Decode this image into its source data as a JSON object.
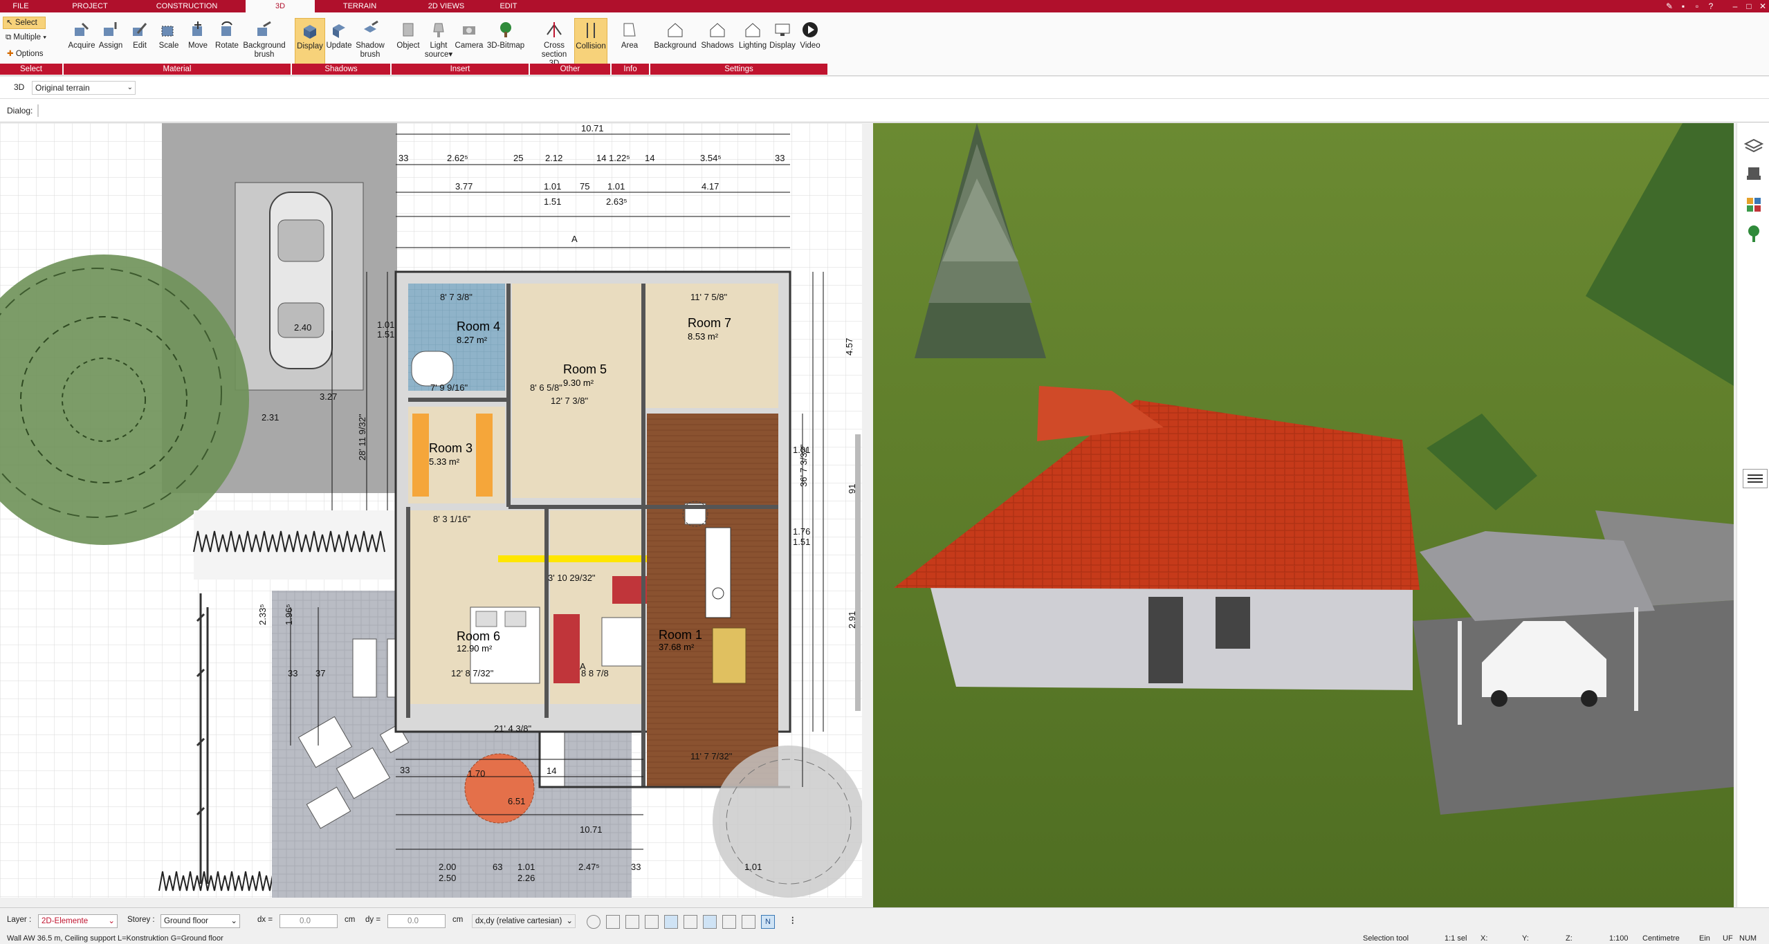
{
  "tabs": [
    {
      "label": "FILE"
    },
    {
      "label": "PROJECT"
    },
    {
      "label": "CONSTRUCTION"
    },
    {
      "label": "3D"
    },
    {
      "label": "TERRAIN"
    },
    {
      "label": "2D VIEWS"
    },
    {
      "label": "EDIT"
    }
  ],
  "ribbon": {
    "select": {
      "select_label": "Select",
      "multiple_label": "Multiple",
      "options_label": "Options"
    },
    "material": {
      "acquire": "Acquire",
      "assign": "Assign",
      "edit": "Edit",
      "scale": "Scale",
      "move": "Move",
      "rotate": "Rotate",
      "background_brush_1": "Background",
      "background_brush_2": "brush"
    },
    "shadows": {
      "display": "Display",
      "update": "Update",
      "shadow_brush_1": "Shadow",
      "shadow_brush_2": "brush"
    },
    "insert": {
      "object": "Object",
      "light_source_1": "Light",
      "light_source_2": "source",
      "camera": "Camera",
      "bitmap": "3D-Bitmap"
    },
    "other": {
      "cross_section_1": "Cross",
      "cross_section_2": "section 3D",
      "collision": "Collision"
    },
    "info": {
      "area": "Area"
    },
    "settings": {
      "background": "Background",
      "shadows": "Shadows",
      "lighting": "Lighting",
      "display": "Display",
      "video": "Video"
    },
    "groups": [
      "Select",
      "Material",
      "Shadows",
      "Insert",
      "Other",
      "Info",
      "Settings"
    ]
  },
  "command_bar": {
    "mode": "3D",
    "terrain_select": "Original terrain"
  },
  "dialog_bar": {
    "label": "Dialog:"
  },
  "plan": {
    "rooms": [
      {
        "name": "Room 4",
        "area": "8.27 m²"
      },
      {
        "name": "Room 7",
        "area": "8.53 m²"
      },
      {
        "name": "Room 5",
        "area": "9.30 m²"
      },
      {
        "name": "Room 3",
        "area": "5.33 m²"
      },
      {
        "name": "Room 6",
        "area": "12.90 m²"
      },
      {
        "name": "Room 1",
        "area": "37.68 m²"
      }
    ],
    "dims": {
      "total_width": "10.71",
      "d1": "33",
      "d2": "2.62⁵",
      "d3": "25",
      "d4": "2.12",
      "d5": "14",
      "d6": "1.22⁵",
      "d7": "14",
      "d8": "3.54⁵",
      "d9": "33",
      "d10": "3.77",
      "d11": "1.01",
      "d12": "75",
      "d13": "1.01",
      "d14": "4.17",
      "d15": "1.51",
      "d16": "2.63⁵",
      "section_label": "A",
      "left1": "1.01",
      "left2": "1.51",
      "left3": "2.40",
      "left4": "3.27",
      "left5": "2.31",
      "left6": "28' 11 9/32\"",
      "right1": "4.57",
      "right2": "1.01",
      "right3": "91",
      "right4": "1.76",
      "right5": "1.51",
      "right6": "36' 7 3/32\"",
      "right7": "2.91",
      "imp1": "11' 7 5/8\"",
      "imp2": "8' 7 3/8\"",
      "imp3": "12' 7 3/8\"",
      "imp4": "8' 6 5/8\"",
      "imp5": "7' 9 9/16\"",
      "imp6": "8' 3 1/16\"",
      "imp7": "12' 8 7/32\"",
      "imp8": "11' 7 7/32\"",
      "imp9": "21' 4 3/8\"",
      "imp10": "3' 10 29/32\"",
      "imp11": "8 8 7/8",
      "bot1": "2.00",
      "bot2": "2.50",
      "bot3": "63",
      "bot4": "1.01",
      "bot5": "2.26",
      "bot6": "2.47⁵",
      "bot7": "33",
      "bot8": "1.01",
      "bot9": "10.71",
      "bot10": "33",
      "bot11": "14",
      "terr1": "2.33⁵",
      "terr2": "1.96⁵",
      "terr3": "37",
      "terr4": "33",
      "terr5": "6.51",
      "terr6": "1.70"
    }
  },
  "input_bar": {
    "layer_label": "Layer :",
    "layer_value": "2D-Elemente",
    "storey_label": "Storey :",
    "storey_value": "Ground floor",
    "dx_label": "dx =",
    "dx_value": "0.0",
    "dx_unit": "cm",
    "dy_label": "dy =",
    "dy_value": "0.0",
    "dy_unit": "cm",
    "coord_mode": "dx,dy (relative cartesian)"
  },
  "status_bar": {
    "info": "Wall AW 36.5 m, Ceiling support L=Konstruktion G=Ground floor",
    "tool": "Selection tool",
    "sel": "1:1 sel",
    "x": "X:",
    "y": "Y:",
    "z": "Z:",
    "scale": "1:100",
    "unit": "Centimetre",
    "ein": "Ein",
    "uf": "UF",
    "num": "NUM"
  },
  "colors": {
    "accent": "#b0102c",
    "roof": "#c43a1c",
    "grass": "#5f7d30",
    "active_btn": "#f7d27a"
  }
}
